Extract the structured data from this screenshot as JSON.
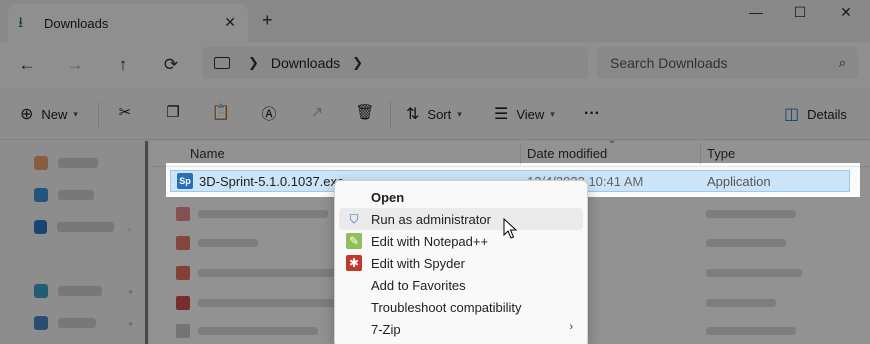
{
  "tab": {
    "title": "Downloads",
    "icon": "download-icon"
  },
  "window_controls": {
    "minimize": "—",
    "maximize": "☐",
    "close": "✕"
  },
  "nav": {
    "back": "←",
    "forward": "→",
    "up": "↑",
    "refresh": "⟳",
    "breadcrumb": [
      "Downloads"
    ],
    "search_placeholder": "Search Downloads"
  },
  "toolbar": {
    "new_label": "New",
    "sort_label": "Sort",
    "view_label": "View",
    "more_label": "···",
    "details_label": "Details"
  },
  "columns": {
    "name": "Name",
    "date_modified": "Date modified",
    "type": "Type"
  },
  "selected_file": {
    "name": "3D-Sprint-5.1.0.1037.exe",
    "date_modified": "12/4/2023 10:41 AM",
    "type": "Application",
    "icon_text": "Sp"
  },
  "context_menu": {
    "items": [
      {
        "label": "Open",
        "icon": "none",
        "bold": true
      },
      {
        "label": "Run as administrator",
        "icon": "uac-shield-icon",
        "hover": true
      },
      {
        "label": "Edit with Notepad++",
        "icon": "notepadpp-icon"
      },
      {
        "label": "Edit with Spyder",
        "icon": "spyder-icon"
      },
      {
        "label": "Add to Favorites",
        "icon": "none"
      },
      {
        "label": "Troubleshoot compatibility",
        "icon": "none"
      },
      {
        "label": "7-Zip",
        "icon": "none",
        "submenu": true
      }
    ]
  },
  "colors": {
    "accent_selection": "#cce4f7",
    "download_green": "#1e8e3e"
  }
}
